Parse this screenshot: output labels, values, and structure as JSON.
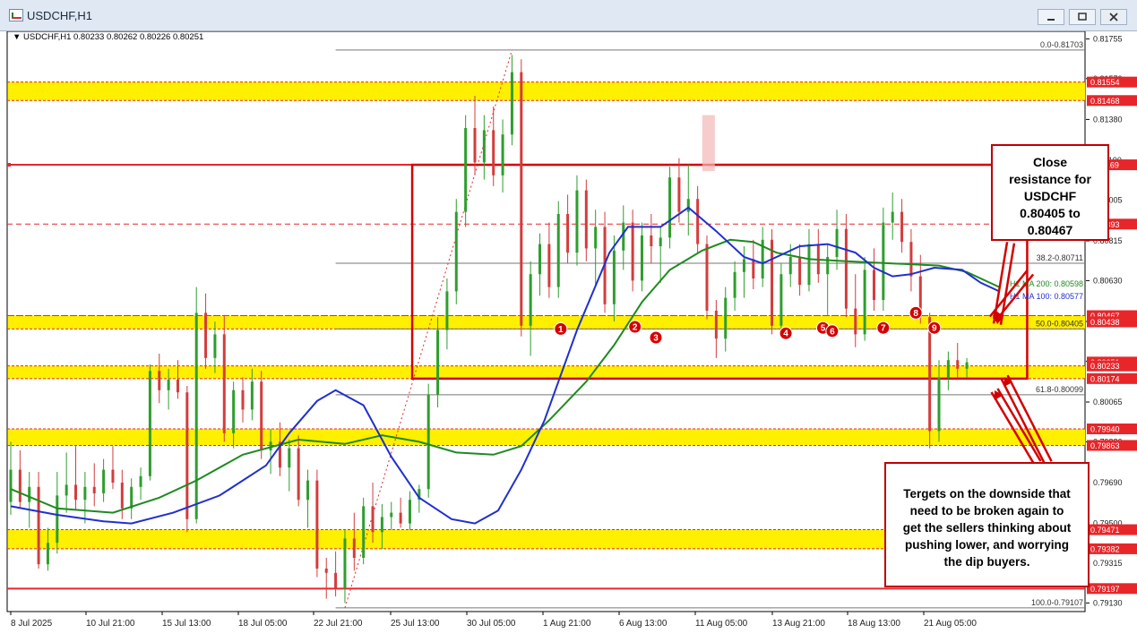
{
  "window": {
    "title": "USDCHF,H1",
    "buttons": [
      "minimize",
      "maximize",
      "close"
    ]
  },
  "chart_header": {
    "symbol": "USDCHF,H1",
    "ohlc": "0.80233 0.80262 0.80226 0.80251"
  },
  "colors": {
    "bull": "#2e9e2e",
    "bear": "#d43c3c",
    "ma_blue": "#1f2fd0",
    "ma_green": "#1f8a1f",
    "zone": "#ffef00",
    "box": "#d40000",
    "price_red": "#e8262a"
  },
  "chart_data": {
    "type": "candlestick",
    "symbol": "USDCHF",
    "timeframe": "H1",
    "ylim": [
      0.7909,
      0.8179
    ],
    "x_ticks": [
      "8 Jul 2025",
      "10 Jul 21:00",
      "15 Jul 13:00",
      "18 Jul 05:00",
      "22 Jul 21:00",
      "25 Jul 13:00",
      "30 Jul 05:00",
      "1 Aug 21:00",
      "6 Aug 13:00",
      "11 Aug 05:00",
      "13 Aug 21:00",
      "18 Aug 13:00",
      "21 Aug 05:00"
    ],
    "y_ticks": [
      "0.81755",
      "0.81570",
      "0.81380",
      "0.81190",
      "0.81005",
      "0.80815",
      "0.80630",
      "0.80440",
      "0.80255",
      "0.80065",
      "0.79880",
      "0.79690",
      "0.79500",
      "0.79315",
      "0.79130"
    ],
    "price_labels": [
      {
        "value": 0.81554,
        "text": "0.81554"
      },
      {
        "value": 0.81468,
        "text": "0.81468"
      },
      {
        "value": 0.81169,
        "text": "0.81169"
      },
      {
        "value": 0.80893,
        "text": "0.80893"
      },
      {
        "value": 0.80467,
        "text": "0.80467"
      },
      {
        "value": 0.80438,
        "text": "0.80438"
      },
      {
        "value": 0.80251,
        "text": "0.80251"
      },
      {
        "value": 0.80233,
        "text": "0.80233"
      },
      {
        "value": 0.80174,
        "text": "0.80174"
      },
      {
        "value": 0.7994,
        "text": "0.79940"
      },
      {
        "value": 0.79863,
        "text": "0.79863"
      },
      {
        "value": 0.79471,
        "text": "0.79471"
      },
      {
        "value": 0.79382,
        "text": "0.79382"
      },
      {
        "value": 0.79197,
        "text": "0.79197"
      }
    ],
    "fib_levels": [
      {
        "value": 0.81703,
        "text": "0.0-0.81703"
      },
      {
        "value": 0.80711,
        "text": "38.2-0.80711"
      },
      {
        "value": 0.80405,
        "text": "50.0-0.80405"
      },
      {
        "value": 0.80099,
        "text": "61.8-0.80099"
      },
      {
        "value": 0.79107,
        "text": "100.0-0.79107"
      }
    ],
    "ma_labels": [
      "H1 MA 200: 0.80598",
      "H1 MA 100: 0.80577"
    ],
    "zones": [
      {
        "from": 0.81468,
        "to": 0.81554
      },
      {
        "from": 0.80405,
        "to": 0.80467
      },
      {
        "from": 0.80174,
        "to": 0.80233
      },
      {
        "from": 0.79863,
        "to": 0.7994
      },
      {
        "from": 0.79382,
        "to": 0.79471
      }
    ],
    "range_box": {
      "top": 0.81169,
      "bottom": 0.80174
    },
    "horizontal_lines": {
      "solid_red": [
        0.81169,
        0.79197
      ],
      "dashed_red": [
        0.80893,
        0.80467
      ]
    },
    "markers": [
      "1",
      "2",
      "3",
      "4",
      "5",
      "6",
      "7",
      "8",
      "9"
    ],
    "ma100_path": [
      [
        0,
        0.7958
      ],
      [
        10,
        0.7954
      ],
      [
        20,
        0.7951
      ],
      [
        26,
        0.795
      ],
      [
        35,
        0.7955
      ],
      [
        45,
        0.7963
      ],
      [
        55,
        0.7977
      ],
      [
        60,
        0.7992
      ],
      [
        66,
        0.8007
      ],
      [
        70,
        0.8012
      ],
      [
        76,
        0.8005
      ],
      [
        82,
        0.7981
      ],
      [
        88,
        0.7962
      ],
      [
        95,
        0.7952
      ],
      [
        100,
        0.795
      ],
      [
        105,
        0.7956
      ],
      [
        110,
        0.7975
      ],
      [
        115,
        0.7998
      ],
      [
        122,
        0.804
      ],
      [
        129,
        0.8076
      ],
      [
        133,
        0.8088
      ],
      [
        140,
        0.8088
      ],
      [
        146,
        0.8097
      ],
      [
        152,
        0.8086
      ],
      [
        158,
        0.8074
      ],
      [
        162,
        0.8071
      ],
      [
        166,
        0.8075
      ],
      [
        170,
        0.8079
      ],
      [
        176,
        0.808
      ],
      [
        182,
        0.8076
      ],
      [
        186,
        0.8069
      ],
      [
        190,
        0.8065
      ],
      [
        194,
        0.8066
      ],
      [
        199,
        0.8069
      ],
      [
        205,
        0.8068
      ],
      [
        209,
        0.8062
      ],
      [
        213,
        0.8058
      ]
    ],
    "ma200_path": [
      [
        0,
        0.7966
      ],
      [
        10,
        0.7957
      ],
      [
        22,
        0.7955
      ],
      [
        32,
        0.7962
      ],
      [
        40,
        0.797
      ],
      [
        50,
        0.7982
      ],
      [
        62,
        0.7989
      ],
      [
        72,
        0.7987
      ],
      [
        80,
        0.7991
      ],
      [
        88,
        0.7988
      ],
      [
        96,
        0.7983
      ],
      [
        104,
        0.7982
      ],
      [
        110,
        0.7986
      ],
      [
        116,
        0.7998
      ],
      [
        124,
        0.8016
      ],
      [
        130,
        0.8033
      ],
      [
        136,
        0.8053
      ],
      [
        142,
        0.8068
      ],
      [
        149,
        0.8077
      ],
      [
        155,
        0.8082
      ],
      [
        160,
        0.8081
      ],
      [
        165,
        0.8076
      ],
      [
        172,
        0.8073
      ],
      [
        180,
        0.8072
      ],
      [
        190,
        0.8071
      ],
      [
        200,
        0.807
      ],
      [
        206,
        0.8067
      ],
      [
        213,
        0.806
      ]
    ],
    "candles": [
      [
        0,
        0.796,
        0.7988,
        0.7954,
        0.7975
      ],
      [
        2,
        0.7975,
        0.7984,
        0.7957,
        0.796
      ],
      [
        4,
        0.796,
        0.7974,
        0.7948,
        0.7967
      ],
      [
        6,
        0.7967,
        0.7974,
        0.7929,
        0.7931
      ],
      [
        8,
        0.7931,
        0.7948,
        0.7928,
        0.7941
      ],
      [
        10,
        0.7941,
        0.7974,
        0.7936,
        0.7963
      ],
      [
        12,
        0.7963,
        0.7983,
        0.7955,
        0.7968
      ],
      [
        14,
        0.7968,
        0.7986,
        0.7956,
        0.7961
      ],
      [
        16,
        0.7961,
        0.7974,
        0.795,
        0.7967
      ],
      [
        18,
        0.7967,
        0.7978,
        0.7958,
        0.7964
      ],
      [
        20,
        0.7964,
        0.798,
        0.796,
        0.7975
      ],
      [
        22,
        0.7975,
        0.7986,
        0.7966,
        0.7969
      ],
      [
        24,
        0.7969,
        0.7975,
        0.7952,
        0.7957
      ],
      [
        26,
        0.7957,
        0.7971,
        0.7952,
        0.7967
      ],
      [
        28,
        0.7967,
        0.7976,
        0.7961,
        0.7972
      ],
      [
        30,
        0.7972,
        0.8024,
        0.797,
        0.8021
      ],
      [
        32,
        0.8021,
        0.8029,
        0.8006,
        0.8012
      ],
      [
        34,
        0.8012,
        0.8022,
        0.8003,
        0.8017
      ],
      [
        36,
        0.8017,
        0.8026,
        0.8008,
        0.8011
      ],
      [
        38,
        0.8011,
        0.8014,
        0.7946,
        0.7952
      ],
      [
        40,
        0.7952,
        0.806,
        0.795,
        0.8048
      ],
      [
        42,
        0.8048,
        0.8057,
        0.8022,
        0.8027
      ],
      [
        44,
        0.8027,
        0.8044,
        0.802,
        0.8038
      ],
      [
        46,
        0.8038,
        0.8047,
        0.7988,
        0.7992
      ],
      [
        48,
        0.7992,
        0.8016,
        0.7985,
        0.8012
      ],
      [
        50,
        0.8012,
        0.8018,
        0.7997,
        0.8003
      ],
      [
        52,
        0.8003,
        0.8022,
        0.7998,
        0.8016
      ],
      [
        54,
        0.8016,
        0.8021,
        0.798,
        0.7984
      ],
      [
        56,
        0.7984,
        0.7994,
        0.7973,
        0.7988
      ],
      [
        58,
        0.7988,
        0.7997,
        0.7972,
        0.7976
      ],
      [
        60,
        0.7976,
        0.7989,
        0.7965,
        0.7985
      ],
      [
        62,
        0.7985,
        0.7991,
        0.7958,
        0.7961
      ],
      [
        64,
        0.7961,
        0.7975,
        0.7948,
        0.797
      ],
      [
        66,
        0.797,
        0.7975,
        0.7925,
        0.7929
      ],
      [
        68,
        0.7929,
        0.7934,
        0.7915,
        0.7927
      ],
      [
        70,
        0.7927,
        0.7937,
        0.7916,
        0.792
      ],
      [
        72,
        0.792,
        0.7947,
        0.7913,
        0.7943
      ],
      [
        74,
        0.7943,
        0.7955,
        0.7928,
        0.7934
      ],
      [
        76,
        0.7934,
        0.7962,
        0.7931,
        0.7958
      ],
      [
        78,
        0.7958,
        0.7969,
        0.7941,
        0.7946
      ],
      [
        80,
        0.7946,
        0.7959,
        0.7938,
        0.7953
      ],
      [
        82,
        0.7953,
        0.796,
        0.7947,
        0.7955
      ],
      [
        84,
        0.7955,
        0.7962,
        0.7948,
        0.795
      ],
      [
        86,
        0.795,
        0.7965,
        0.7947,
        0.7961
      ],
      [
        88,
        0.7961,
        0.7968,
        0.7955,
        0.7966
      ],
      [
        90,
        0.7966,
        0.8015,
        0.7962,
        0.801
      ],
      [
        92,
        0.801,
        0.8046,
        0.8004,
        0.804
      ],
      [
        94,
        0.804,
        0.8064,
        0.8031,
        0.8058
      ],
      [
        96,
        0.8058,
        0.8101,
        0.8052,
        0.8095
      ],
      [
        98,
        0.8095,
        0.814,
        0.8088,
        0.8134
      ],
      [
        100,
        0.8134,
        0.8149,
        0.8112,
        0.8118
      ],
      [
        102,
        0.8118,
        0.814,
        0.811,
        0.8133
      ],
      [
        104,
        0.8133,
        0.8144,
        0.8107,
        0.8112
      ],
      [
        106,
        0.8112,
        0.8138,
        0.8104,
        0.8131
      ],
      [
        108,
        0.8131,
        0.8168,
        0.8126,
        0.816
      ],
      [
        110,
        0.816,
        0.8166,
        0.8037,
        0.8042
      ],
      [
        112,
        0.8042,
        0.8072,
        0.8028,
        0.8066
      ],
      [
        114,
        0.8066,
        0.8085,
        0.8056,
        0.808
      ],
      [
        116,
        0.808,
        0.809,
        0.8055,
        0.806
      ],
      [
        118,
        0.806,
        0.81,
        0.8055,
        0.8094
      ],
      [
        120,
        0.8094,
        0.8103,
        0.8071,
        0.8076
      ],
      [
        122,
        0.8076,
        0.8112,
        0.807,
        0.8105
      ],
      [
        124,
        0.8105,
        0.811,
        0.8072,
        0.8078
      ],
      [
        126,
        0.8078,
        0.8096,
        0.806,
        0.8088
      ],
      [
        128,
        0.8088,
        0.8095,
        0.8048,
        0.8052
      ],
      [
        130,
        0.8052,
        0.8084,
        0.8044,
        0.8077
      ],
      [
        132,
        0.8077,
        0.8098,
        0.8068,
        0.809
      ],
      [
        134,
        0.809,
        0.8096,
        0.8058,
        0.8063
      ],
      [
        136,
        0.8063,
        0.809,
        0.8058,
        0.8084
      ],
      [
        138,
        0.8084,
        0.8094,
        0.8071,
        0.8079
      ],
      [
        140,
        0.8079,
        0.8088,
        0.8062,
        0.8083
      ],
      [
        142,
        0.8083,
        0.8116,
        0.8078,
        0.8111
      ],
      [
        144,
        0.8111,
        0.812,
        0.809,
        0.8095
      ],
      [
        146,
        0.8095,
        0.8117,
        0.8084,
        0.8101
      ],
      [
        148,
        0.8101,
        0.8107,
        0.8076,
        0.808
      ],
      [
        150,
        0.808,
        0.8084,
        0.8045,
        0.8049
      ],
      [
        152,
        0.8049,
        0.8054,
        0.8027,
        0.8036
      ],
      [
        154,
        0.8036,
        0.806,
        0.803,
        0.8055
      ],
      [
        156,
        0.8055,
        0.8072,
        0.8049,
        0.8067
      ],
      [
        158,
        0.8067,
        0.8079,
        0.8055,
        0.8073
      ],
      [
        160,
        0.8073,
        0.8082,
        0.8059,
        0.8064
      ],
      [
        162,
        0.8064,
        0.8088,
        0.806,
        0.8082
      ],
      [
        164,
        0.8082,
        0.8087,
        0.8038,
        0.8042
      ],
      [
        166,
        0.8042,
        0.8071,
        0.8039,
        0.8066
      ],
      [
        168,
        0.8066,
        0.808,
        0.806,
        0.8074
      ],
      [
        170,
        0.8074,
        0.808,
        0.8056,
        0.8061
      ],
      [
        172,
        0.8061,
        0.8087,
        0.8058,
        0.808
      ],
      [
        174,
        0.808,
        0.8087,
        0.8062,
        0.8066
      ],
      [
        176,
        0.8066,
        0.808,
        0.8047,
        0.8074
      ],
      [
        178,
        0.8074,
        0.8096,
        0.8068,
        0.8087
      ],
      [
        180,
        0.8087,
        0.8094,
        0.8046,
        0.805
      ],
      [
        182,
        0.805,
        0.8066,
        0.8032,
        0.8038
      ],
      [
        184,
        0.8038,
        0.8074,
        0.8035,
        0.8068
      ],
      [
        186,
        0.8068,
        0.8078,
        0.8049,
        0.8054
      ],
      [
        188,
        0.8054,
        0.8097,
        0.8049,
        0.809
      ],
      [
        190,
        0.809,
        0.8104,
        0.8082,
        0.8095
      ],
      [
        192,
        0.8095,
        0.8101,
        0.8076,
        0.8081
      ],
      [
        194,
        0.8081,
        0.8087,
        0.8058,
        0.8065
      ],
      [
        196,
        0.8065,
        0.8075,
        0.8043,
        0.8046
      ],
      [
        198,
        0.8046,
        0.8048,
        0.7985,
        0.7993
      ],
      [
        200,
        0.7993,
        0.8026,
        0.7988,
        0.8018
      ],
      [
        202,
        0.8018,
        0.803,
        0.8012,
        0.8026
      ],
      [
        204,
        0.8026,
        0.8034,
        0.8018,
        0.8022
      ],
      [
        206,
        0.8022,
        0.8027,
        0.8018,
        0.8025
      ]
    ]
  },
  "annotations": {
    "resistance_note": [
      "Close",
      "resistance for",
      "USDCHF",
      "0.80405 to",
      "0.80467"
    ],
    "targets_note": [
      "Tergets on the downside that",
      "need to be broken again to",
      "get the sellers thinking about",
      "pushing lower, and worrying",
      "the dip buyers."
    ]
  }
}
